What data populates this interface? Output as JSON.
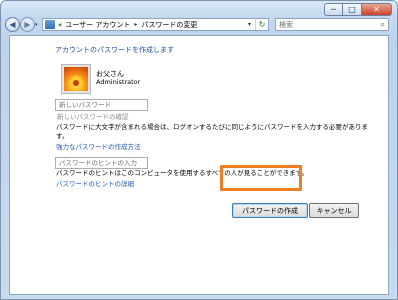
{
  "window": {
    "controls": {
      "minimize": "─",
      "maximize": "□",
      "close": "✕"
    }
  },
  "nav": {
    "back_glyph": "◀",
    "forward_glyph": "▶",
    "dropdown_glyph": "▾",
    "address": {
      "overflow": "«",
      "crumbs": [
        "ユーザー アカウント",
        "パスワードの変更"
      ],
      "separator": "▸",
      "dropdown_glyph": "▾",
      "refresh_glyph": "↻"
    },
    "search": {
      "placeholder": "検索",
      "icon": "search-icon",
      "glyph": "⌕"
    }
  },
  "main": {
    "heading": "アカウントのパスワードを作成します",
    "user": {
      "name": "お父さん",
      "role": "Administrator",
      "avatar_icon": "flower-avatar"
    },
    "new_password": {
      "placeholder": "新しいパスワード",
      "value": ""
    },
    "confirm_password": {
      "placeholder": "新しいパスワードの確認",
      "value": ""
    },
    "case_note": "パスワードに大文字が含まれる場合は、ログオンするたびに同じようにパスワードを入力する必要がありま",
    "case_note_cont": "す。",
    "strong_password_link": "強力なパスワードの作成方法",
    "hint": {
      "placeholder": "パスワードのヒントの入力",
      "value": ""
    },
    "hint_note": "パスワードのヒントはこのコンピュータを使用するすべての人が見ることができます。",
    "hint_link": "パスワードのヒントの詳細",
    "create_button": "パスワードの作成",
    "cancel_button": "キャンセル"
  },
  "colors": {
    "link": "#1f58b0",
    "highlight": "#ef7f22",
    "window_frame": "#c4d9ef"
  }
}
